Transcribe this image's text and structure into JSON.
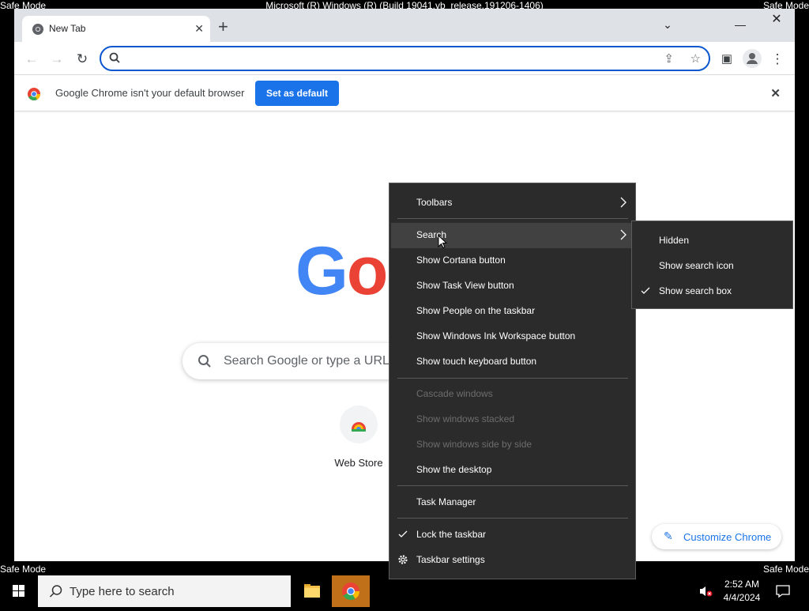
{
  "screen": {
    "safe_mode_label": "Safe Mode",
    "window_title": "Microsoft (R) Windows (R) (Build 19041.vb_release.191206-1406)"
  },
  "chrome": {
    "tab_title": "New Tab",
    "infobar": {
      "message": "Google Chrome isn't your default browser",
      "button": "Set as default"
    },
    "ntp": {
      "logo_visible": "Go",
      "search_placeholder": "Search Google or type a URL",
      "shortcut_label": "Web Store",
      "customize_label": "Customize Chrome"
    }
  },
  "context_menu": {
    "items": [
      {
        "label": "Toolbars"
      },
      {
        "label": "Search"
      },
      {
        "label": "Show Cortana button"
      },
      {
        "label": "Show Task View button"
      },
      {
        "label": "Show People on the taskbar"
      },
      {
        "label": "Show Windows Ink Workspace button"
      },
      {
        "label": "Show touch keyboard button"
      },
      {
        "label": "Cascade windows"
      },
      {
        "label": "Show windows stacked"
      },
      {
        "label": "Show windows side by side"
      },
      {
        "label": "Show the desktop"
      },
      {
        "label": "Task Manager"
      },
      {
        "label": "Lock the taskbar"
      },
      {
        "label": "Taskbar settings"
      }
    ]
  },
  "search_submenu": {
    "items": [
      {
        "label": "Hidden"
      },
      {
        "label": "Show search icon"
      },
      {
        "label": "Show search box"
      }
    ]
  },
  "taskbar": {
    "search_placeholder": "Type here to search",
    "time": "2:52 AM",
    "date": "4/4/2024"
  },
  "colors": {
    "accent": "#1a73e8",
    "menu_bg": "#2b2b2b",
    "menu_hover": "#414141"
  }
}
